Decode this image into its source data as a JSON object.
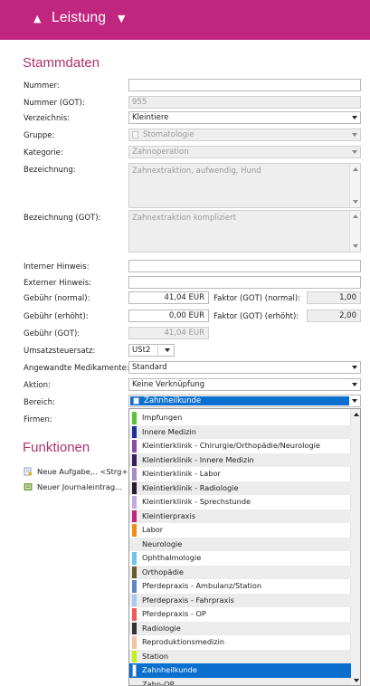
{
  "header": {
    "title": "Leistung",
    "collapse_icon": "triangle-up-icon",
    "menu_icon": "triangle-down-icon",
    "bg_color": "#c0267e"
  },
  "stammdaten": {
    "title": "Stammdaten",
    "labels": {
      "nummer": "Nummer:",
      "nummer_got": "Nummer (GOT):",
      "verzeichnis": "Verzeichnis:",
      "gruppe": "Gruppe:",
      "kategorie": "Kategorie:",
      "bezeichnung": "Bezeichnung:",
      "bezeichnung_got": "Bezeichnung (GOT):",
      "interner_hinweis": "Interner Hinweis:",
      "externer_hinweis": "Externer Hinweis:",
      "gebuehr_normal": "Gebühr (normal):",
      "gebuehr_erhoeht": "Gebühr (erhöht):",
      "gebuehr_got": "Gebühr (GOT):",
      "umsatzsteuersatz": "Umsatzsteuersatz:",
      "medikamente": "Angewandte Medikamente:",
      "aktion": "Aktion:",
      "bereich": "Bereich:",
      "firmen": "Firmen:"
    },
    "values": {
      "nummer": "",
      "nummer_got": "955",
      "verzeichnis": "Kleintiere",
      "gruppe": "Stomatologie",
      "kategorie": "Zahnoperation",
      "bezeichnung": "Zahnextraktion, aufwendig, Hund",
      "bezeichnung_got": "Zahnextraktion kompliziert",
      "interner_hinweis": "",
      "externer_hinweis": "",
      "gebuehr_normal": "41,04 EUR",
      "gebuehr_erhoeht": "0,00 EUR",
      "gebuehr_got": "41,04 EUR",
      "umsatzsteuersatz": "USt2",
      "medikamente": "Standard",
      "aktion": "Keine Verknüpfung",
      "bereich": "Zahnheilkunde"
    },
    "factor": {
      "normal_label": "Faktor (GOT) (normal):",
      "normal_value": "1,00",
      "erhoeht_label": "Faktor (GOT) (erhöht):",
      "erhoeht_value": "2,00"
    }
  },
  "funktionen": {
    "title": "Funktionen",
    "items": [
      {
        "label": "Neue Aufgabe,.. <Strg+",
        "icon": "new-task-icon"
      },
      {
        "label": "Neuer Journaleintrag...",
        "icon": "new-journal-entry-icon"
      }
    ]
  },
  "bereich_options": [
    {
      "label": "Impfungen",
      "color": "#5cc23a"
    },
    {
      "label": "Innere Medizin",
      "color": "#1f2f9e"
    },
    {
      "label": "Kleintierklinik - Chirurgie/Orthopädie/Neurologie",
      "color": "#8a4aa8"
    },
    {
      "label": "Kleintierklinik - Innere Medizin",
      "color": "#3a1f5e"
    },
    {
      "label": "Kleintierklinik - Labor",
      "color": "#a98bc6"
    },
    {
      "label": "Kleintierklinik - Radiologie",
      "color": "#2b1a33"
    },
    {
      "label": "Kleintierklinik - Sprechstunde",
      "color": "#c8a8dc"
    },
    {
      "label": "Kleintierpraxis",
      "color": "#c0267e"
    },
    {
      "label": "Labor",
      "color": "#f28c18"
    },
    {
      "label": "Neurologie",
      "color": ""
    },
    {
      "label": "Ophthalmologie",
      "color": "#6fc3ee"
    },
    {
      "label": "Orthopädie",
      "color": "#6b5a2a"
    },
    {
      "label": "Pferdepraxis - Ambulanz/Station",
      "color": "#5b86c4"
    },
    {
      "label": "Pferdepraxis - Fahrpraxis",
      "color": "#a9c8ec"
    },
    {
      "label": "Pferdepraxis - OP",
      "color": "#ef5a5a"
    },
    {
      "label": "Radiologie",
      "color": "#333333"
    },
    {
      "label": "Reproduktionsmedizin",
      "color": "#f7c0a0"
    },
    {
      "label": "Station",
      "color": "#c6ee1a"
    },
    {
      "label": "Zahnheilkunde",
      "color": "#ffffff"
    },
    {
      "label": "Zahn-OP",
      "color": ""
    }
  ],
  "bereich_selected_index": 18
}
